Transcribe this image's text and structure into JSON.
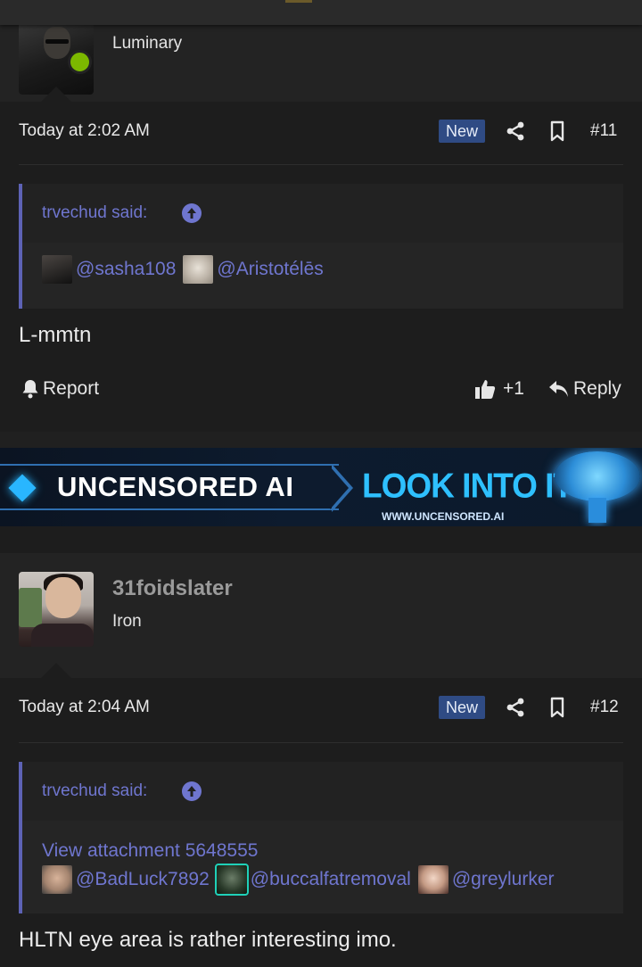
{
  "post11": {
    "user_title": "Luminary",
    "date": "Today at 2:02 AM",
    "badge": "New",
    "number": "#11",
    "quote_author": "trvechud said:",
    "mentions": [
      "@sasha108",
      "@Aristotélēs"
    ],
    "message": "L-mmtn",
    "report_label": "Report",
    "like_count": "+1",
    "reply_label": "Reply"
  },
  "banner": {
    "brand": "UNCENSORED AI",
    "cta": "LOOK INTO IT",
    "url": "WWW.UNCENSORED.AI"
  },
  "post12": {
    "username": "31foidslater",
    "user_title": "Iron",
    "date": "Today at 2:04 AM",
    "badge": "New",
    "number": "#12",
    "quote_author": "trvechud said:",
    "attachment": "View attachment 5648555",
    "mentions": [
      "@BadLuck7892",
      "@buccalfatremoval",
      "@greylurker"
    ],
    "message": "HLTN eye area is rather interesting imo."
  },
  "colors": {
    "background": "#1d1d1d",
    "link": "#6f76cf",
    "badge_new": "#2f4b84",
    "online": "#7cb800",
    "quote_border": "#5d62b5"
  }
}
